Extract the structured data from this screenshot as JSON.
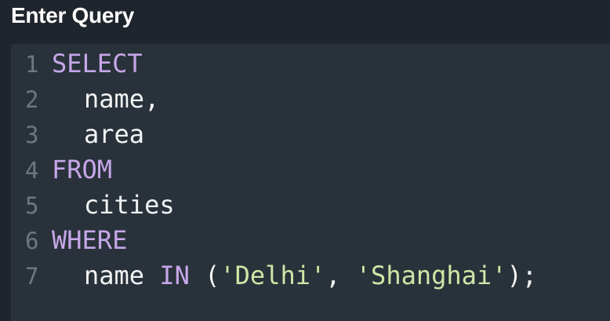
{
  "header": {
    "title": "Enter Query"
  },
  "editor": {
    "lines": [
      {
        "number": "1",
        "keyword": "SELECT"
      },
      {
        "number": "2",
        "identifier": "name",
        "punct": ","
      },
      {
        "number": "3",
        "identifier": "area"
      },
      {
        "number": "4",
        "keyword": "FROM"
      },
      {
        "number": "5",
        "identifier": "cities"
      },
      {
        "number": "6",
        "keyword": "WHERE"
      },
      {
        "number": "7",
        "identifier": "name",
        "keyword": "IN",
        "open": "(",
        "str1": "'Delhi'",
        "comma": ",",
        "str2": "'Shanghai'",
        "close": ");"
      }
    ]
  },
  "colors": {
    "background": "#1f252c",
    "editor_background": "#29323a",
    "keyword": "#c6a7e9",
    "string": "#cfe6a7",
    "identifier": "#f2f3f4",
    "line_number": "#6b7882"
  }
}
